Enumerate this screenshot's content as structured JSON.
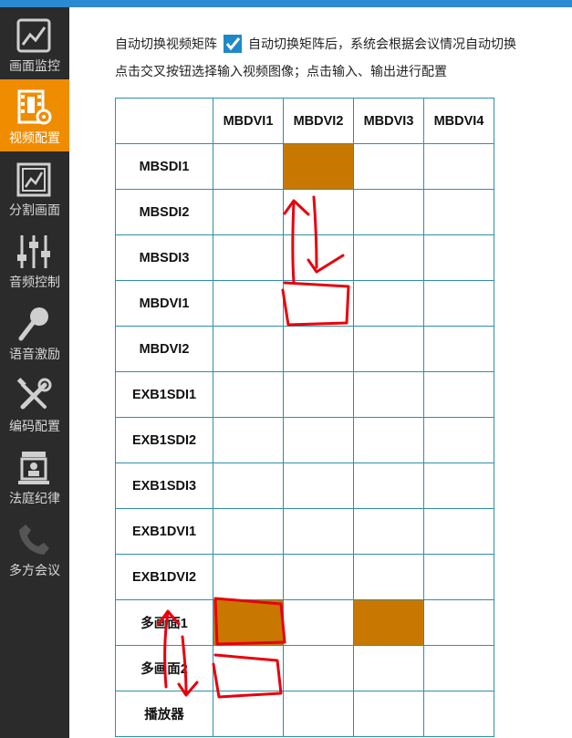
{
  "sidebar": {
    "items": [
      {
        "label": "画面监控",
        "icon": "monitor-chart-icon",
        "active": false
      },
      {
        "label": "视频配置",
        "icon": "film-gear-icon",
        "active": true
      },
      {
        "label": "分割画面",
        "icon": "split-screen-icon",
        "active": false
      },
      {
        "label": "音频控制",
        "icon": "audio-sliders-icon",
        "active": false
      },
      {
        "label": "语音激励",
        "icon": "microphone-icon",
        "active": false
      },
      {
        "label": "编码配置",
        "icon": "wrench-screwdriver-icon",
        "active": false
      },
      {
        "label": "法庭纪律",
        "icon": "court-discipline-icon",
        "active": false
      },
      {
        "label": "多方会议",
        "icon": "phone-icon",
        "active": false
      }
    ]
  },
  "main": {
    "auto_switch_label": "自动切换视频矩阵",
    "auto_switch_checked": true,
    "auto_switch_desc": "自动切换矩阵后，系统会根据会议情况自动切换",
    "instruction": "点击交叉按钮选择输入视频图像；点击输入、输出进行配置"
  },
  "matrix": {
    "outputs": [
      "MBDVI1",
      "MBDVI2",
      "MBDVI3",
      "MBDVI4"
    ],
    "inputs": [
      "MBSDI1",
      "MBSDI2",
      "MBSDI3",
      "MBDVI1",
      "MBDVI2",
      "EXB1SDI1",
      "EXB1SDI2",
      "EXB1SDI3",
      "EXB1DVI1",
      "EXB1DVI2",
      "多画面1",
      "多画面2",
      "播放器"
    ],
    "active_cells": [
      [
        0,
        1
      ],
      [
        10,
        0
      ],
      [
        10,
        2
      ]
    ],
    "active_color": "#c87800"
  },
  "annotation_color": "#e8000c"
}
